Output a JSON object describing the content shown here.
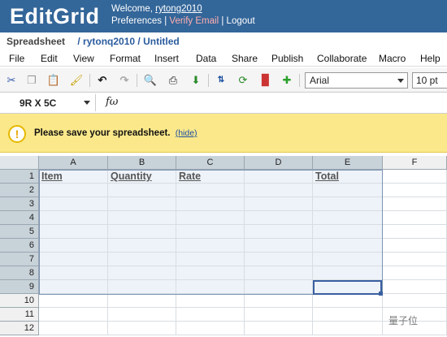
{
  "app": {
    "logo": "EditGrid",
    "welcome_prefix": "Welcome,",
    "username": "rytong2010",
    "preferences": "Preferences",
    "verify_email": "Verify Email",
    "logout": "Logout",
    "separator": "|"
  },
  "breadcrumb": {
    "section": "Spreadsheet",
    "path": "/ rytonq2010 / Untitled"
  },
  "menu": [
    "File",
    "Edit",
    "View",
    "Format",
    "Insert",
    "Data",
    "Share",
    "Publish",
    "Collaborate",
    "Macro",
    "Help"
  ],
  "toolbar": {
    "icons": [
      "cut-icon",
      "copy-icon",
      "paste-icon",
      "format-painter-icon",
      "undo-icon",
      "redo-icon",
      "find-icon",
      "print-icon",
      "download-icon",
      "sort-icon",
      "refresh-icon",
      "chart-icon",
      "plugin-icon"
    ],
    "font": "Arial",
    "font_size": "10 pt"
  },
  "formula_bar": {
    "cell_ref": "9R X 5C",
    "fx_symbol": "fω",
    "value": ""
  },
  "notice": {
    "icon": "!",
    "message": "Please save your spreadsheet.",
    "hide_link": "(hide)"
  },
  "grid": {
    "columns": [
      "A",
      "B",
      "C",
      "D",
      "E",
      "F"
    ],
    "rows": [
      "1",
      "2",
      "3",
      "4",
      "5",
      "6",
      "7",
      "8",
      "9",
      "10",
      "11",
      "12"
    ],
    "header_cells": {
      "A1": "Item",
      "B1": "Quantity",
      "C1": "Rate",
      "E1": "Total"
    },
    "selection": "A1:E9",
    "active_cell": "E9"
  },
  "watermark": "量子位",
  "colors": {
    "topbar": "#336699",
    "notice": "#fbe88a",
    "selection_header": "#c8d2d9",
    "verify": "#ffb0b0"
  }
}
